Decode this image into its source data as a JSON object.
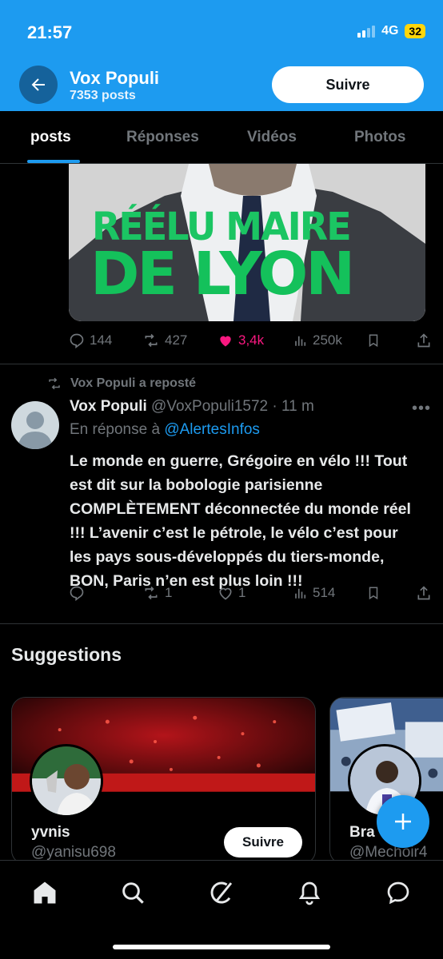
{
  "status_bar": {
    "time": "21:57",
    "network": "4G",
    "battery": "32"
  },
  "header": {
    "title": "Vox Populi",
    "posts_count": "7353 posts",
    "follow_label": "Suivre",
    "accent_color": "#1d9bf0"
  },
  "tabs": [
    {
      "label": "posts",
      "active": true
    },
    {
      "label": "Réponses",
      "active": false
    },
    {
      "label": "Vidéos",
      "active": false
    },
    {
      "label": "Photos",
      "active": false
    }
  ],
  "media_post": {
    "image_text_line1": "RÉÉLU MAIRE",
    "image_text_line2": "DE LYON",
    "actions": {
      "replies": "144",
      "reposts": "427",
      "likes": "3,4k",
      "views": "250k"
    }
  },
  "reposted_tweet": {
    "repost_label": "Vox Populi a reposté",
    "author_name": "Vox Populi",
    "author_handle": "@VoxPopuli1572",
    "time": " · 11 m",
    "reply_prefix": "En réponse à ",
    "reply_mention": "@AlertesInfos",
    "text": "Le monde en guerre, Grégoire en vélo !!! Tout est dit sur la bobologie parisienne COMPLÈTEMENT déconnectée du monde réel !!! L’avenir c’est le pétrole, le vélo c’est pour les pays sous-développés du tiers-monde, BON, Paris n’en est plus loin !!!",
    "actions": {
      "replies": "",
      "reposts": "1",
      "likes": "1",
      "views": "514"
    }
  },
  "suggestions": {
    "title": "Suggestions",
    "cards": [
      {
        "name": "yvnis",
        "handle": "@yanisu698",
        "follow_label": "Suivre"
      },
      {
        "name": "Bra",
        "handle": "@Mechoir4"
      }
    ]
  },
  "bottom_nav": {
    "items": [
      "home-icon",
      "search-icon",
      "grok-icon",
      "notifications-icon",
      "messages-icon"
    ]
  }
}
